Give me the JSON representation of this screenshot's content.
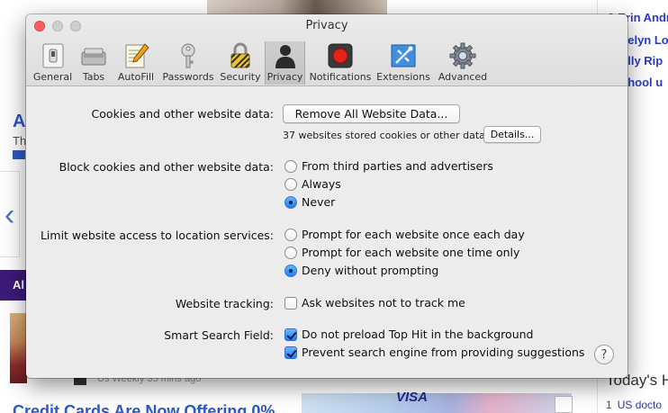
{
  "background_page": {
    "right_links": [
      "Erin Andr",
      "velyn Lo",
      "elly Rip",
      "chool u"
    ],
    "right_link_num": "0",
    "left_heading_fragment": "A",
    "left_text_fragment": "Th",
    "purple_tab_fragment": "Al",
    "source_fragment": "Us Weekly   35 mins ago",
    "credit_headline": "Credit Cards Are Now Offering 0%",
    "ad_brand": "VISA",
    "today_heading": "Today's H",
    "today_item_num": "1",
    "today_item_text": "US docto"
  },
  "window": {
    "title": "Privacy",
    "toolbar": [
      {
        "label": "General",
        "icon": "switch-icon"
      },
      {
        "label": "Tabs",
        "icon": "tabs-icon"
      },
      {
        "label": "AutoFill",
        "icon": "autofill-icon"
      },
      {
        "label": "Passwords",
        "icon": "key-icon"
      },
      {
        "label": "Security",
        "icon": "lock-icon"
      },
      {
        "label": "Privacy",
        "icon": "person-silhouette-icon",
        "selected": true
      },
      {
        "label": "Notifications",
        "icon": "notification-icon"
      },
      {
        "label": "Extensions",
        "icon": "puzzle-icon"
      },
      {
        "label": "Advanced",
        "icon": "gear-icon"
      }
    ]
  },
  "privacy": {
    "cookies": {
      "label": "Cookies and other website data:",
      "remove_button": "Remove All Website Data...",
      "stored_note": "37 websites stored cookies or other data",
      "details_button": "Details..."
    },
    "block_cookies": {
      "label": "Block cookies and other website data:",
      "options": [
        "From third parties and advertisers",
        "Always",
        "Never"
      ],
      "selected": "Never"
    },
    "location": {
      "label": "Limit website access to location services:",
      "options": [
        "Prompt for each website once each day",
        "Prompt for each website one time only",
        "Deny without prompting"
      ],
      "selected": "Deny without prompting"
    },
    "tracking": {
      "label": "Website tracking:",
      "checkbox": "Ask websites not to track me",
      "checked": false
    },
    "smart_search": {
      "label": "Smart Search Field:",
      "options": [
        {
          "text": "Do not preload Top Hit in the background",
          "checked": true
        },
        {
          "text": "Prevent search engine from providing suggestions",
          "checked": true
        }
      ]
    },
    "help_label": "?"
  },
  "colors": {
    "accent_blue": "#1f7cf0",
    "close_red": "#fc605c",
    "window_bg": "#ececec",
    "link_blue": "#2b3cc9"
  }
}
